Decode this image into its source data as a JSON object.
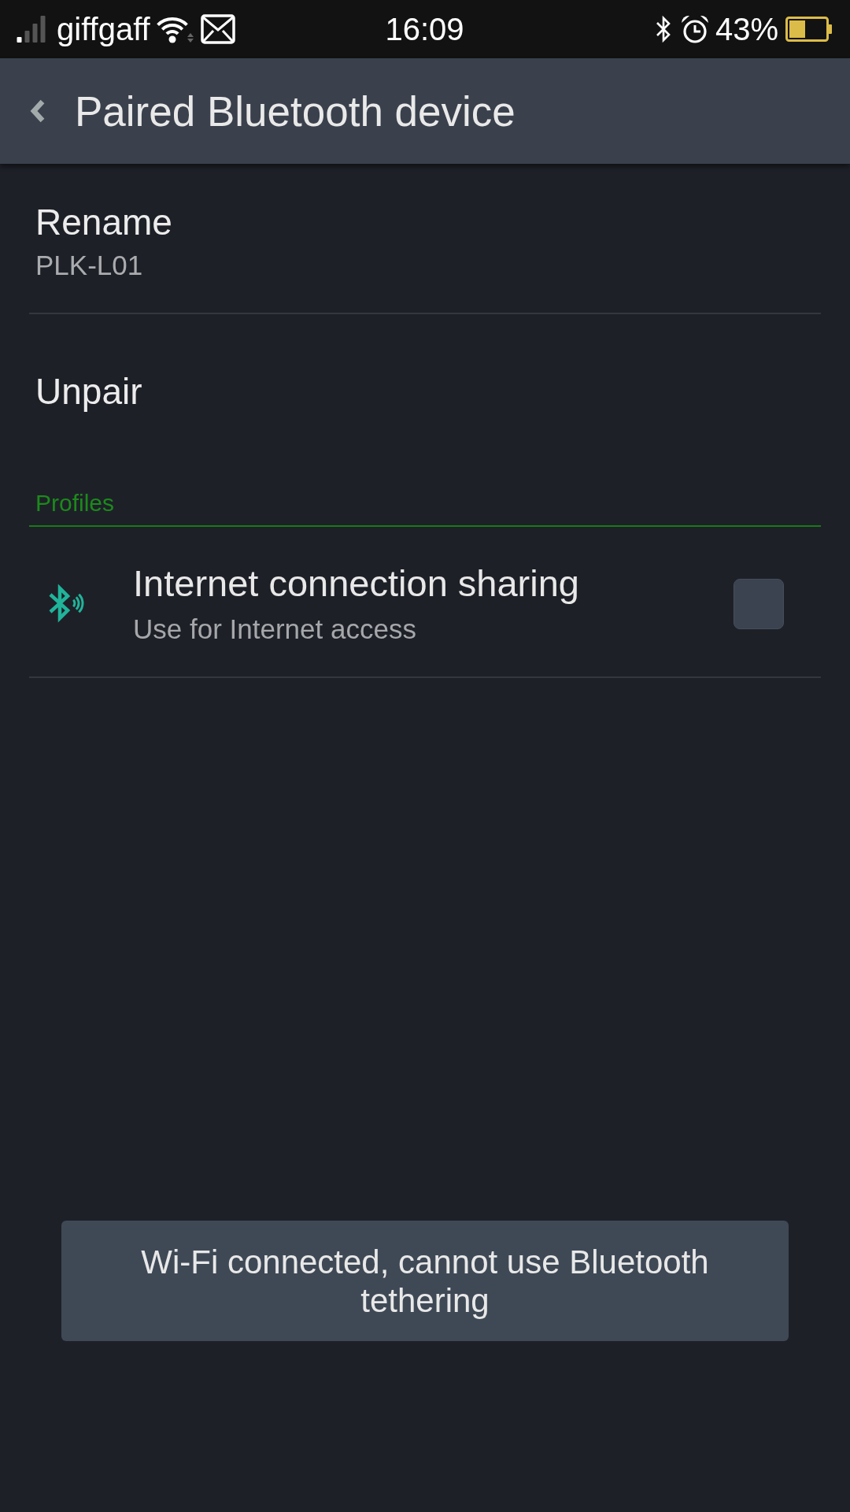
{
  "status_bar": {
    "carrier": "giffgaff",
    "time": "16:09",
    "battery": "43%"
  },
  "app_bar": {
    "title": "Paired Bluetooth device"
  },
  "options": [
    {
      "title": "Rename",
      "value": "PLK-L01"
    },
    {
      "title": "Unpair"
    }
  ],
  "section": {
    "title": "Profiles"
  },
  "profiles": [
    {
      "title": "Internet connection sharing",
      "description": "Use for Internet access",
      "checked": false
    }
  ],
  "toast": {
    "message": "Wi-Fi connected, cannot use Bluetooth tethering"
  }
}
